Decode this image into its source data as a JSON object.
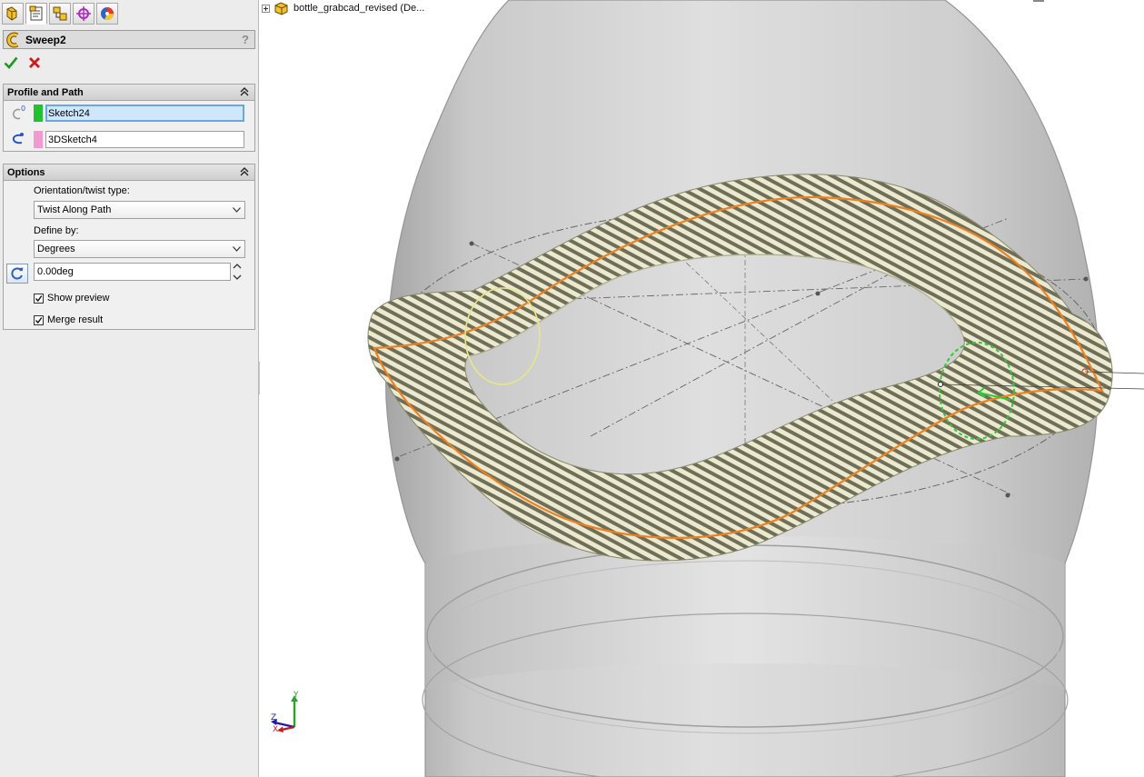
{
  "property_manager": {
    "tabs": [
      {
        "name": "featuremanager-tab",
        "icon": "feature-tree-icon"
      },
      {
        "name": "propertymanager-tab",
        "icon": "property-sheet-icon"
      },
      {
        "name": "configurationmanager-tab",
        "icon": "configuration-icon"
      },
      {
        "name": "dimxpert-tab",
        "icon": "dimxpert-crosshair-icon"
      },
      {
        "name": "display-manager-tab",
        "icon": "appearance-pie-icon"
      }
    ],
    "feature_title": "Sweep2",
    "help_label": "?",
    "ok_icon": "green-check-icon",
    "cancel_icon": "red-x-icon",
    "colors": {
      "profile_swatch": "#21c12f",
      "path_swatch": "#f19ad0",
      "selection_active": "#cfe6fb"
    }
  },
  "profile_and_path": {
    "title": "Profile and Path",
    "profile": "Sketch24",
    "path": "3DSketch4"
  },
  "options": {
    "title": "Options",
    "orientation_label": "Orientation/twist type:",
    "orientation_value": "Twist Along Path",
    "define_by_label": "Define by:",
    "define_by_value": "Degrees",
    "angle_value": "0.00deg",
    "show_preview_label": "Show preview",
    "show_preview_checked": true,
    "merge_result_label": "Merge result",
    "merge_result_checked": true
  },
  "graphics": {
    "tree_item": "bottle_grabcad_revised  (De...",
    "triad": {
      "x": "X",
      "y": "Y",
      "z": "Z"
    },
    "colors": {
      "path_curve": "#f07f1e",
      "profile_circle": "#2fc93a",
      "guide_circle": "#e9e68a",
      "stripe_dark": "#6f6f58",
      "stripe_light": "#ebe9cf"
    }
  }
}
